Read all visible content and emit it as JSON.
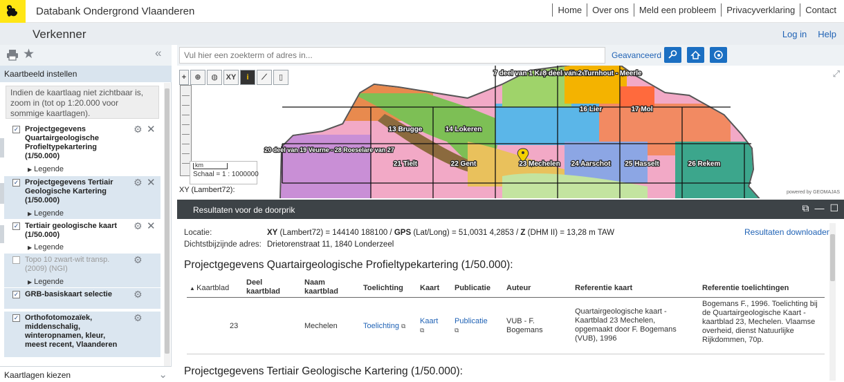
{
  "topbar": {
    "site_title": "Databank Ondergrond Vlaanderen",
    "nav": [
      "Home",
      "Over ons",
      "Meld een probleem",
      "Privacyverklaring",
      "Contact"
    ],
    "brand_color": "#ffe615"
  },
  "subbar": {
    "app_title": "Verkenner",
    "login": "Log in",
    "help": "Help"
  },
  "leftpanel": {
    "header": "Kaartbeeld instellen",
    "note": "Indien de kaartlaag niet zichtbaar is, zoom in (tot op 1:20.000 voor sommige kaartlagen).",
    "legend_label": "Legende",
    "layers": [
      {
        "name": "Projectgegevens Quartairgeologische Profieltypekartering (1/50.000)",
        "checked": true,
        "has_legend": true
      },
      {
        "name": "Projectgegevens Tertiair Geologische Kartering (1/50.000)",
        "checked": true,
        "has_legend": true
      },
      {
        "name": "Tertiair geologische kaart (1/50.000)",
        "checked": true,
        "has_legend": true
      },
      {
        "name": "Topo 10 zwart-wit transp. (2009) (NGI)",
        "checked": false,
        "has_legend": true
      },
      {
        "name": "GRB-basiskaart selectie",
        "checked": true,
        "has_legend": false
      },
      {
        "name": "Orthofotomozaïek, middenschalig, winteropnamen, kleur, meest recent, Vlaanderen",
        "checked": true,
        "has_legend": false
      }
    ],
    "footer": "Kaartlagen kiezen"
  },
  "search": {
    "placeholder": "Vul hier een zoekterm of adres in...",
    "advanced": "Geavanceerd",
    "button_color": "#1b6fc2"
  },
  "map": {
    "tools": [
      "+",
      "zoom-icon",
      "globe-icon",
      "XY",
      "info-icon",
      "measure-icon",
      "print-icon"
    ],
    "xy_button": "XY",
    "scale_unit": "km",
    "scale_text": "Schaal = 1 : 1000000",
    "xy_label": "XY (Lambert72):",
    "powered_by": "powered by GEOMAJAS",
    "sheets": [
      {
        "label": "7 deel van 1 Kapellen - Essen"
      },
      {
        "label": "8 deel van 2 Turnhout - Meerle"
      },
      {
        "label": "16 Lier"
      },
      {
        "label": "17 Mol"
      },
      {
        "label": "13 Brugge"
      },
      {
        "label": "14 Lokeren"
      },
      {
        "label": "20 deel van 19 Veurne - 28 Roeselare van 27"
      },
      {
        "label": "21 Tielt"
      },
      {
        "label": "22 Gent"
      },
      {
        "label": "23 Mechelen"
      },
      {
        "label": "24 Aarschot"
      },
      {
        "label": "25 Hasselt"
      },
      {
        "label": "26 Rekem"
      }
    ]
  },
  "results": {
    "title": "Resultaten voor de doorprik",
    "download": "Resultaten downloaden",
    "location_label": "Locatie:",
    "location_xy_label": "XY",
    "location_xy_crs": "(Lambert72) = 144140 188100 /",
    "location_gps_label": "GPS",
    "location_gps_val": "(Lat/Long) = 51,0031 4,2853 /",
    "location_z_label": "Z",
    "location_z_val": "(DHM II) = 13,28 m TAW",
    "address_label": "Dichtstbijzijnde adres:",
    "address_value": "Drietorenstraat 11, 1840 Londerzeel",
    "section1_title": "Projectgegevens Quartairgeologische Profieltypekartering (1/50.000):",
    "section2_title": "Projectgegevens Tertiair Geologische Kartering (1/50.000):",
    "columns": [
      "Kaartblad",
      "Deel kaartblad",
      "Naam kaartblad",
      "Toelichting",
      "Kaart",
      "Publicatie",
      "Auteur",
      "Referentie kaart",
      "Referentie toelichtingen"
    ],
    "rows": [
      {
        "kaartblad": "23",
        "deel": "",
        "naam": "Mechelen",
        "toelichting": "Toelichting",
        "kaart": "Kaart",
        "publicatie": "Publicatie",
        "auteur": "VUB - F. Bogemans",
        "ref_kaart": "Quartairgeologische kaart - Kaartblad 23 Mechelen, opgemaakt door F. Bogemans (VUB), 1996",
        "ref_toel": "Bogemans F., 1996. Toelichting bij de Quartairgeologische Kaart - kaartblad 23, Mechelen. Vlaamse overheid, dienst Natuurlijke Rijkdommen, 70p."
      }
    ]
  }
}
